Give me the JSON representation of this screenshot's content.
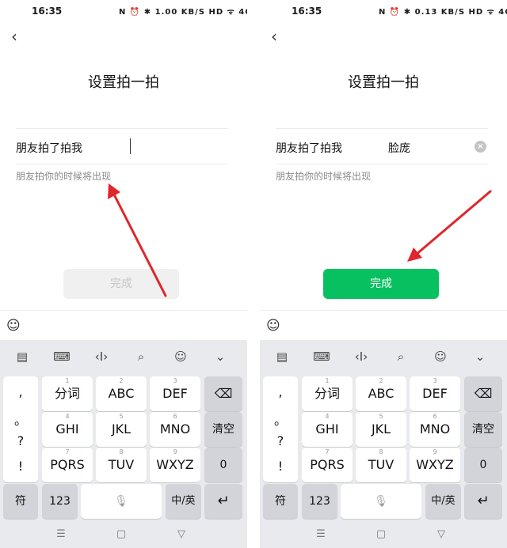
{
  "status": {
    "time": "16:35",
    "left_icons": "N ⏰ ✱ 1.00 KB/S HD ᯤ 4G 4G ◑",
    "right_icons": "N ⏰ ✱ 0.13 KB/S HD ᯤ 4G 4G ◑"
  },
  "page": {
    "title": "设置拍一拍",
    "field_label": "朋友拍了拍我",
    "hint": "朋友拍你的时候将出现",
    "done_label": "完成",
    "back_icon": "‹"
  },
  "right_field_value": "脸庞",
  "colors": {
    "accent": "#07c160",
    "arrow": "#e0262b"
  },
  "keyboard": {
    "toolbar_icons": [
      "clipboard-icon",
      "keyboard-icon",
      "cursor-icon",
      "search-icon",
      "emoji-icon",
      "chevron-down-icon"
    ],
    "punct": [
      ",",
      "。",
      "?",
      "!"
    ],
    "row1": [
      {
        "num": "1",
        "label": "分词"
      },
      {
        "num": "2",
        "label": "ABC"
      },
      {
        "num": "3",
        "label": "DEF"
      }
    ],
    "row2": [
      {
        "num": "4",
        "label": "GHI"
      },
      {
        "num": "5",
        "label": "JKL"
      },
      {
        "num": "6",
        "label": "MNO"
      }
    ],
    "row3": [
      {
        "num": "7",
        "label": "PQRS"
      },
      {
        "num": "8",
        "label": "TUV"
      },
      {
        "num": "9",
        "label": "WXYZ"
      }
    ],
    "backspace": "⌫",
    "clear": "清空",
    "zero": "0",
    "symbol": "符",
    "num123": "123",
    "mic": "🎙",
    "lang": "中/英",
    "enter": "↵"
  },
  "nav": {
    "menu": "☰",
    "home": "▢",
    "back": "▽"
  }
}
